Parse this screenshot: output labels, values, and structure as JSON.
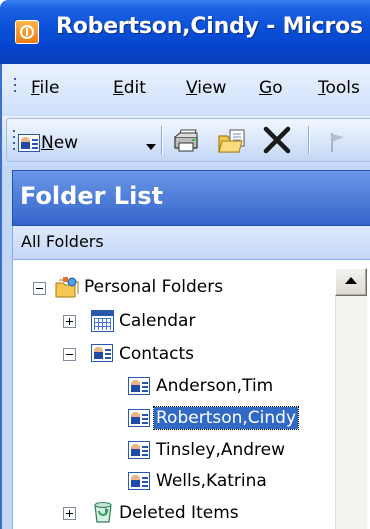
{
  "window": {
    "title": "Robertson,Cindy - Micros"
  },
  "menubar": {
    "items": [
      {
        "underline": "F",
        "rest": "ile"
      },
      {
        "underline": "E",
        "rest": "dit"
      },
      {
        "underline": "V",
        "rest": "iew"
      },
      {
        "underline": "G",
        "rest": "o"
      },
      {
        "underline": "T",
        "rest": "ools"
      }
    ]
  },
  "toolbar": {
    "new_underline": "N",
    "new_rest": "ew",
    "icons": [
      "contact-card-icon",
      "dropdown-arrow-icon",
      "print-icon",
      "move-to-folder-icon",
      "delete-icon",
      "flag-icon"
    ]
  },
  "folder_pane": {
    "title": "Folder List",
    "subheader": "All Folders"
  },
  "tree": {
    "personal_folders": "Personal Folders",
    "calendar": "Calendar",
    "contacts": "Contacts",
    "contact_items": [
      {
        "label": "Anderson,Tim",
        "selected": false
      },
      {
        "label": "Robertson,Cindy",
        "selected": true
      },
      {
        "label": "Tinsley,Andrew",
        "selected": false
      },
      {
        "label": "Wells,Katrina",
        "selected": false
      }
    ],
    "deleted_items": "Deleted Items"
  },
  "colors": {
    "titlebar": "#0a4fd6",
    "selection": "#316ac5",
    "pane_header": "#3565c9"
  }
}
